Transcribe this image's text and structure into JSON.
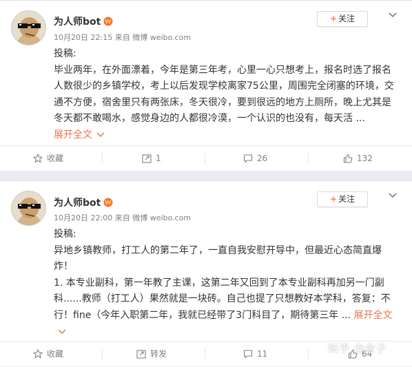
{
  "posts": [
    {
      "username": "为人师bot",
      "meta_time": "10月20日 22:15",
      "meta_source_prefix": "来自",
      "meta_source": "微博 weibo.com",
      "follow_label": "关注",
      "lines": [
        "投稿:",
        "毕业两年，在外面漂着，今年是第三年考，心里一心只想考上，报名时选了报名人数很少的乡镇学校，考上以后发现学校离家75公里，周围完全闭塞的环境，交通不方便，宿舍里只有两张床，冬天很冷，要到很远的地方上厕所，晚上尤其是冬天都不敢喝水，感觉身边的人都很冷漠，一个认识的也没有，每天活 ..."
      ],
      "expand_label": "展开全文",
      "actions": {
        "collect": "收藏",
        "repost": "1",
        "comment": "26",
        "like": "132"
      }
    },
    {
      "username": "为人师bot",
      "meta_time": "10月20日 22:00",
      "meta_source_prefix": "来自",
      "meta_source": "微博 weibo.com",
      "follow_label": "关注",
      "lines": [
        "投稿:",
        "异地乡镇教师，打工人的第二年了，一直自我安慰开导中，但最近心态简直爆炸！",
        "1. 本专业副科，第一年教了主课，这第二年又回到了本专业副科再加另一门副科......教师（打工人）果然就是一块砖。自己也提了只想教好本学科，答复：不行！fine（今年入职第二年，我就已经带了3门科目了，期待第三年 ..."
      ],
      "expand_label": "展开全文",
      "actions": {
        "collect": "收藏",
        "repost": "转发",
        "comment": "11",
        "like": "64"
      }
    }
  ],
  "watermark": "知乎 @金子",
  "colors": {
    "accent_orange": "#eb7350",
    "plus_orange": "#ff8140",
    "meta_gray": "#808080",
    "background": "#e9ecf1"
  },
  "icons": {
    "collect": "star-outline-icon",
    "repost": "share-arrow-icon",
    "comment": "comment-bubble-icon",
    "like": "thumbs-up-icon",
    "more": "chevron-down-icon",
    "vip": "vip-badge-icon"
  }
}
